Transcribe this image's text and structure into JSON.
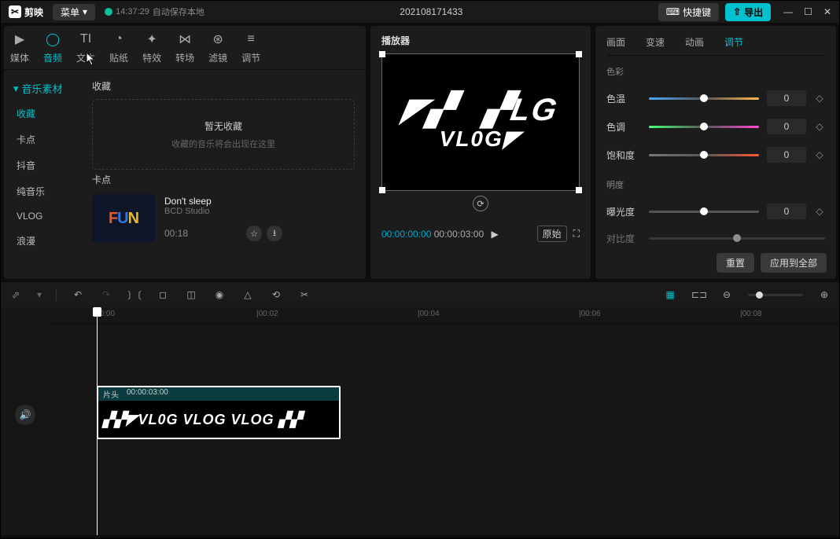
{
  "titleBar": {
    "appName": "剪映",
    "menuLabel": "菜单",
    "saveTime": "14:37:29",
    "saveText": "自动保存本地",
    "projectName": "202108171433",
    "shortcutLabel": "快捷键",
    "exportLabel": "导出"
  },
  "libTabs": [
    {
      "id": "media",
      "label": "媒体"
    },
    {
      "id": "audio",
      "label": "音频"
    },
    {
      "id": "text",
      "label": "文本"
    },
    {
      "id": "sticker",
      "label": "贴纸"
    },
    {
      "id": "effect",
      "label": "特效"
    },
    {
      "id": "transition",
      "label": "转场"
    },
    {
      "id": "filter",
      "label": "滤镜"
    },
    {
      "id": "adjust",
      "label": "调节"
    }
  ],
  "sidebar": {
    "head": "音乐素材",
    "items": [
      "收藏",
      "卡点",
      "抖音",
      "纯音乐",
      "VLOG",
      "浪漫"
    ],
    "activeIndex": 0
  },
  "library": {
    "favTitle": "收藏",
    "emptyMain": "暂无收藏",
    "emptySub": "收藏的音乐将会出现在这里",
    "sectionTitle": "卡点",
    "card": {
      "title": "Don't sleep",
      "artist": "BCD Studio",
      "duration": "00:18"
    }
  },
  "preview": {
    "title": "播放器",
    "time": {
      "current": "00:00:00:00",
      "total": "00:00:03:00"
    },
    "originalLabel": "原始"
  },
  "inspector": {
    "tabs": [
      "画面",
      "变速",
      "动画",
      "调节"
    ],
    "activeTab": 3,
    "groupColor": "色彩",
    "groupBright": "明度",
    "rows": {
      "temp": {
        "label": "色温",
        "value": "0"
      },
      "tint": {
        "label": "色调",
        "value": "0"
      },
      "sat": {
        "label": "饱和度",
        "value": "0"
      },
      "exp": {
        "label": "曝光度",
        "value": "0"
      },
      "contrast": {
        "label": "对比度",
        "value": "0"
      }
    },
    "resetLabel": "重置",
    "applyAllLabel": "应用到全部"
  },
  "timeline": {
    "ticks": [
      "00:00",
      "|00:02",
      "|00:04",
      "|00:06",
      "|00:08"
    ],
    "clip": {
      "tag": "片头",
      "duration": "00:00:03:00",
      "thumbText": "▞▞◤VL0G VLOG VLOG ▞▞"
    }
  }
}
